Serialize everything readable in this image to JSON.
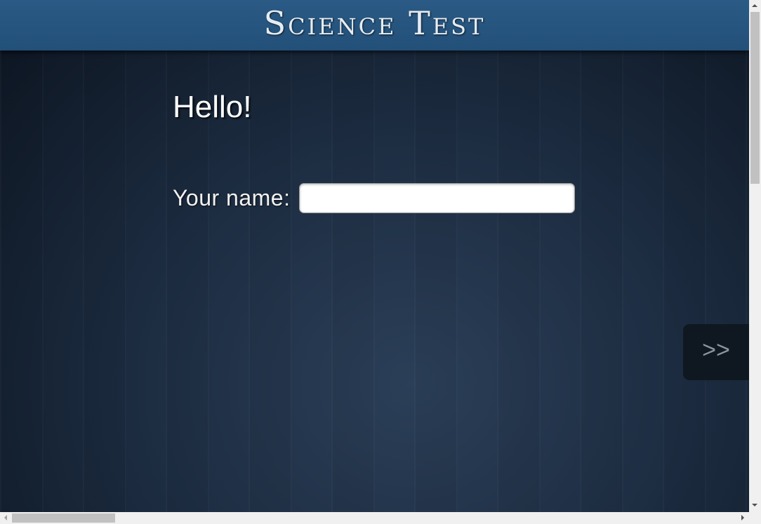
{
  "header": {
    "title": "Science Test"
  },
  "main": {
    "greeting": "Hello!",
    "name_label": "Your name:",
    "name_value": "",
    "name_placeholder": ""
  },
  "navigation": {
    "next_label": ">>"
  },
  "colors": {
    "header_bg": "#225079",
    "page_bg": "#1d2d42",
    "next_button_bg": "#0f1821"
  },
  "scroll": {
    "vertical_position": 0,
    "horizontal_position": 0
  }
}
